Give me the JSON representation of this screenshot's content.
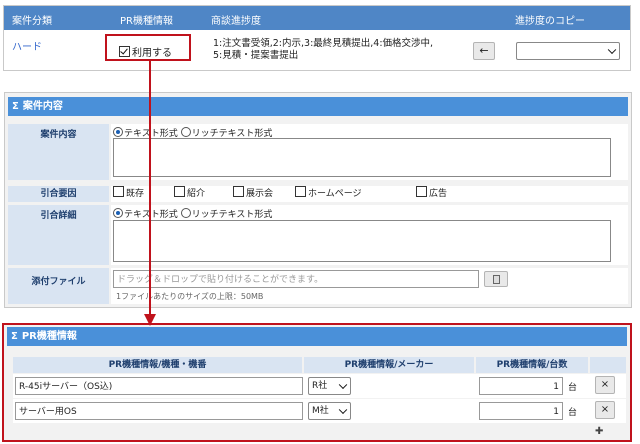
{
  "top": {
    "headers": [
      "案件分類",
      "PR機種情報",
      "商談進捗度",
      "進捗度のコピー"
    ],
    "category_link": "ハード",
    "pr_checkbox_label": "利用する",
    "progress_line1": "1:注文書受領,2:内示,3:最終見積提出,4:価格交渉中,",
    "progress_line2": "5:見積・提案書提出",
    "arrow_button": "←",
    "copy_select_value": ""
  },
  "case_section": {
    "title": "案件内容",
    "icon": "sigma-icon",
    "rows": {
      "content_label": "案件内容",
      "format_text": "テキスト形式",
      "format_rich": "リッチテキスト形式",
      "cause_label": "引合要因",
      "cause_options": [
        "既存",
        "紹介",
        "展示会",
        "ホームページ",
        "広告"
      ],
      "detail_label": "引合詳細",
      "attach_label": "添付ファイル",
      "attach_placeholder": "ドラッグ＆ドロップで貼り付けることができます。",
      "attach_note": "1ファイルあたりのサイズの上限：50MB",
      "attach_icon": "clipboard-icon"
    }
  },
  "pr_section": {
    "title": "PR機種情報",
    "columns": [
      "PR機種情報/機種・機番",
      "PR機種情報/メーカー",
      "PR機種情報/台数"
    ],
    "unit": "台",
    "rows": [
      {
        "model": "R-45iサーバー（OS込)",
        "maker": "R社",
        "qty": "1"
      },
      {
        "model": "サーバー用OS",
        "maker": "M社",
        "qty": "1"
      }
    ],
    "delete_symbol": "×",
    "add_symbol": "✚"
  },
  "colors": {
    "top_header": "#4f86c6",
    "section_bar": "#4a90d9",
    "label_bg": "#d9e4f2",
    "highlight": "#c0121c"
  }
}
